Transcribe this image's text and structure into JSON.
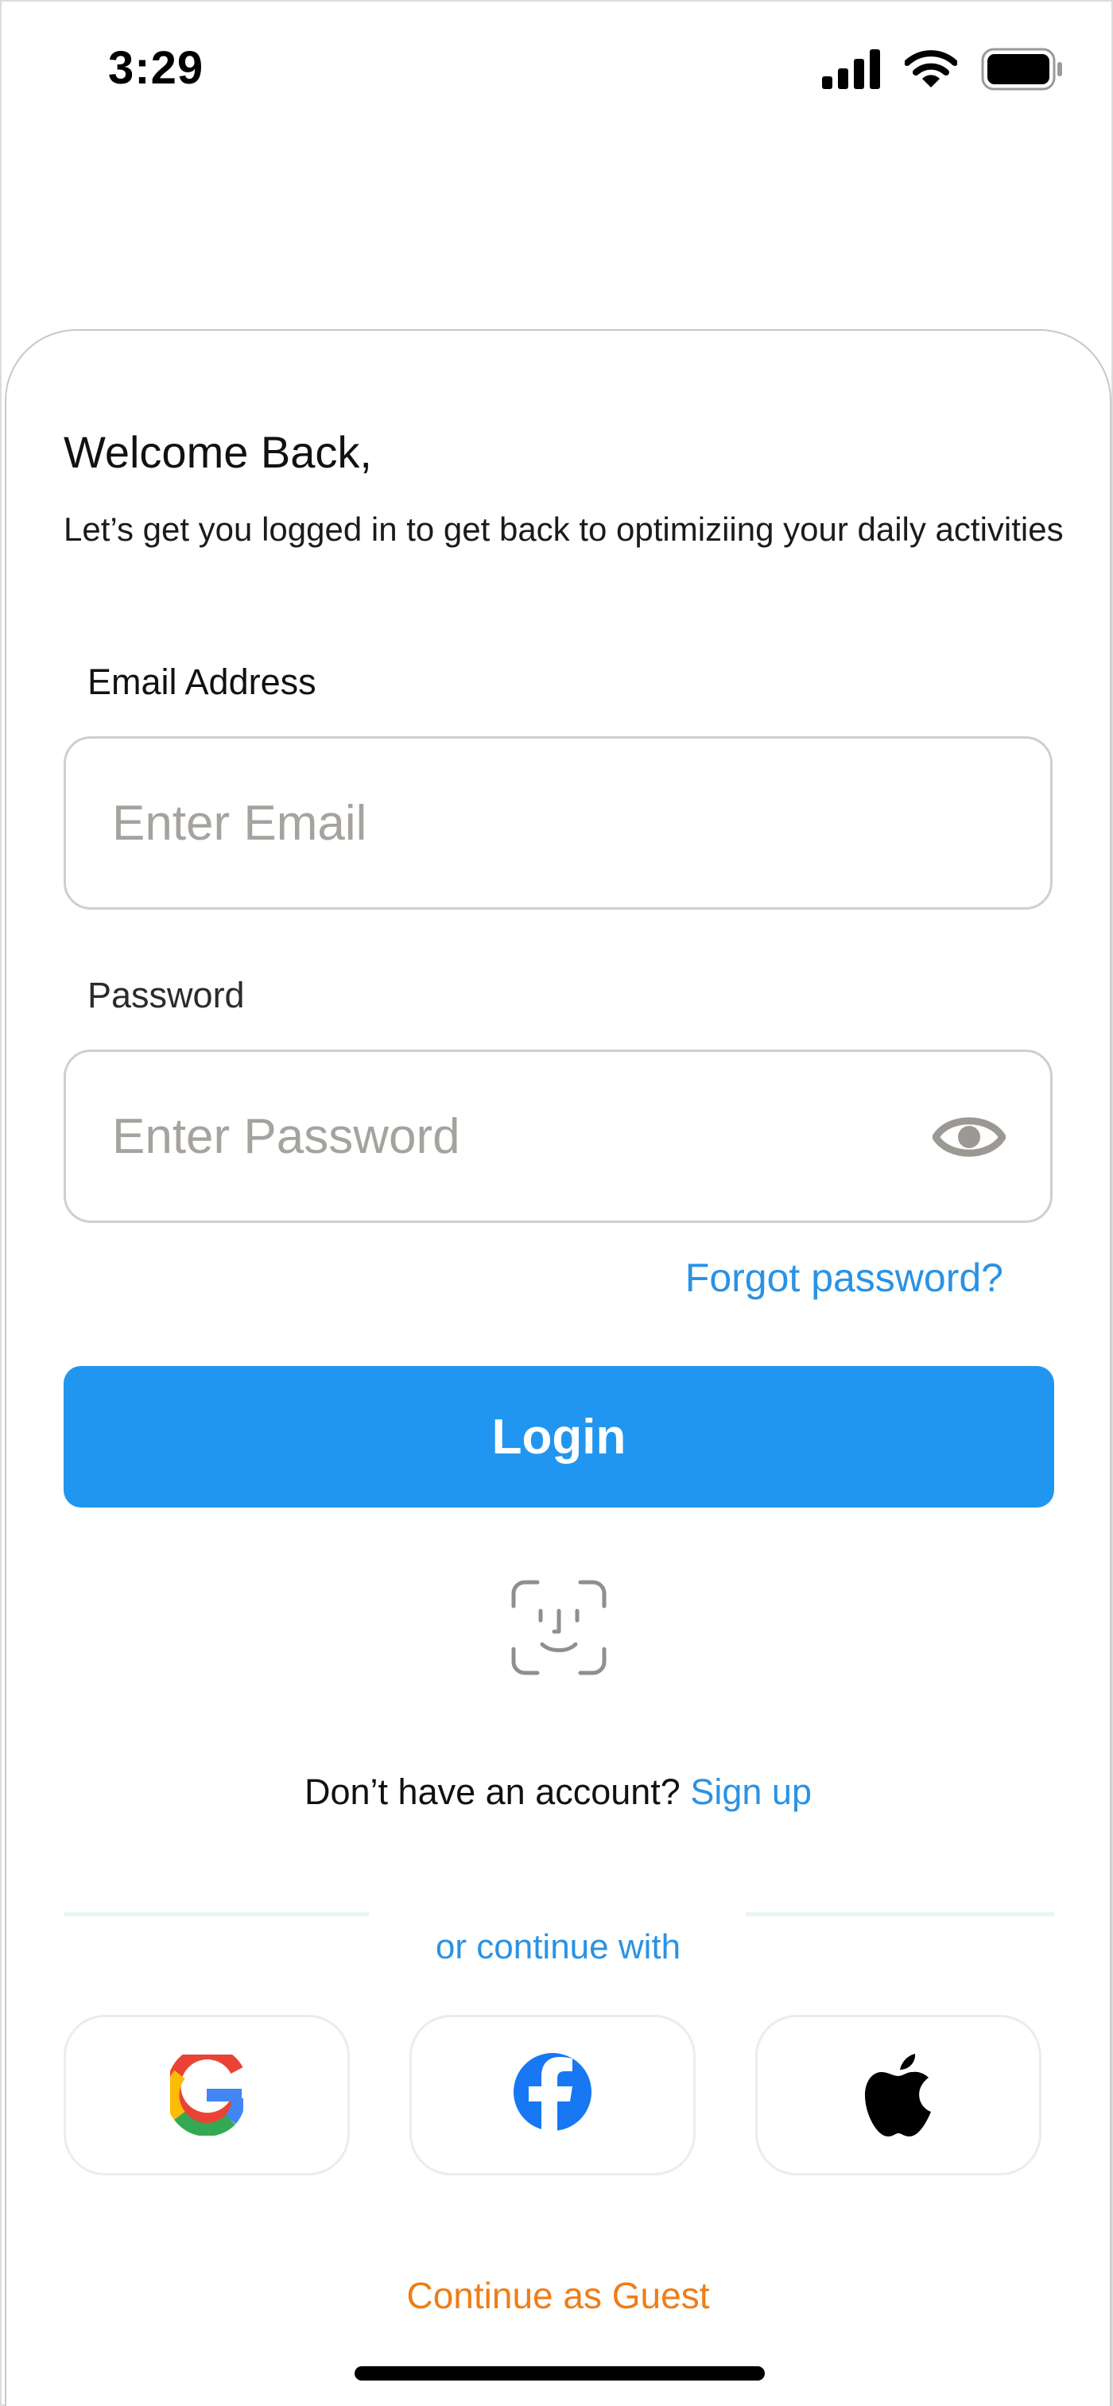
{
  "status_bar": {
    "time": "3:29",
    "icons": [
      "cellular-signal-icon",
      "wifi-icon",
      "battery-icon"
    ]
  },
  "welcome": {
    "title": "Welcome Back,",
    "subtitle": "Let’s get you logged in to get back to optimiziing your daily activities"
  },
  "email": {
    "label": "Email Address",
    "value": "",
    "placeholder": "Enter Email"
  },
  "password": {
    "label": "Password",
    "value": "",
    "placeholder": "Enter Password",
    "toggle_icon": "eye-icon"
  },
  "forgot_password": "Forgot password?",
  "login_button": "Login",
  "face_id_icon": "face-id-icon",
  "signup": {
    "prompt": "Don’t have an account?",
    "link": "Sign up"
  },
  "continue_with": "or continue with",
  "social": [
    {
      "name": "google",
      "icon": "google-icon"
    },
    {
      "name": "facebook",
      "icon": "facebook-icon"
    },
    {
      "name": "apple",
      "icon": "apple-icon"
    }
  ],
  "guest": "Continue as Guest",
  "colors": {
    "primary": "#2196f0",
    "link": "#2a92e4",
    "guest": "#ef7d17",
    "placeholder": "#a6a39e",
    "divider": "#e6f6f3"
  }
}
